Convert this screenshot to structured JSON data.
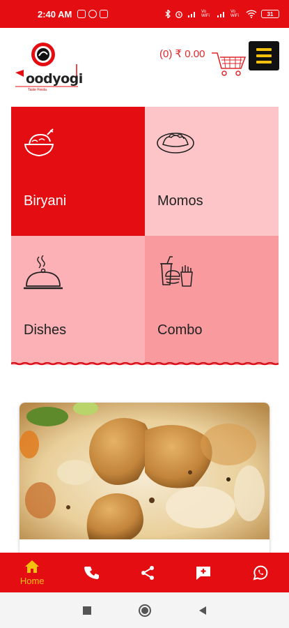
{
  "status_bar": {
    "time": "2:40 AM",
    "battery": "31",
    "network_labels": [
      "Vo WiFi",
      "Vo WiFi"
    ]
  },
  "header": {
    "logo_text": "oodyogi",
    "logo_tagline": "Taste Fiesta",
    "cart_price": "(0) ₹ 0.00"
  },
  "categories": [
    {
      "label": "Biryani",
      "icon": "biryani-chicken-icon"
    },
    {
      "label": "Momos",
      "icon": "momos-icon"
    },
    {
      "label": "Dishes",
      "icon": "cloche-icon"
    },
    {
      "label": "Combo",
      "icon": "combo-icon"
    }
  ],
  "bottom_nav": {
    "home_label": "Home",
    "items": [
      "home-icon",
      "phone-icon",
      "share-icon",
      "feedback-icon",
      "whatsapp-icon"
    ]
  },
  "colors": {
    "primary": "#e30d12",
    "accent": "#f4c20d",
    "tile_light": "#fdc5c8",
    "tile_mid": "#fbb1b5",
    "tile_pink": "#f99a9f"
  }
}
